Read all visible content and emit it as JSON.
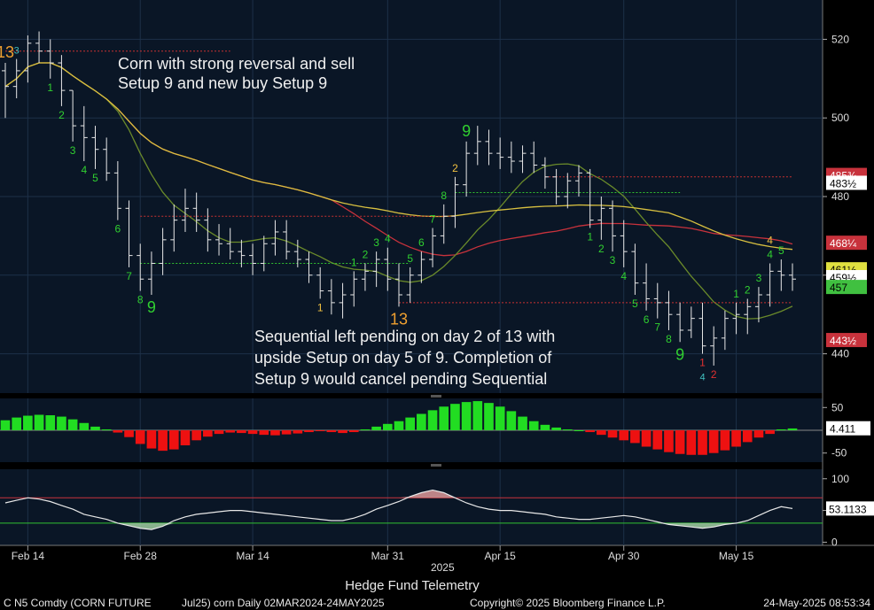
{
  "chart_data": {
    "type": "candlestick",
    "title": "",
    "instrument": "C N5 Comdty (CORN FUTURE    Jul25) corn  Daily 02MAR2024-24MAY2025",
    "footer_left": "C N5 Comdty (CORN FUTURE",
    "footer_mid": "Jul25) corn  Daily 02MAR2024-24MAY2025",
    "copyright": "Copyright© 2025 Bloomberg Finance L.P.",
    "timestamp": "24-May-2025 08:53:34",
    "watermark": "Hedge Fund Telemetry",
    "year_label": "2025",
    "date_ticks": [
      "Feb 14",
      "Feb 28",
      "Mar 14",
      "Mar 31",
      "Apr 15",
      "Apr 30",
      "May 15"
    ],
    "date_tick_index": [
      2,
      12,
      22,
      34,
      44,
      55,
      65
    ],
    "price_axis": {
      "ticks": [
        440,
        460,
        480,
        500,
        520
      ],
      "ylim": [
        430,
        530
      ]
    },
    "price_labels": {
      "last_left": "483½",
      "ma_red": "468¼",
      "last": "459½",
      "target": "443½",
      "hidden_a": "485¾",
      "hidden_b": "461½",
      "hidden_c": "457"
    },
    "ohlc": [
      [
        512,
        514,
        500,
        508
      ],
      [
        508,
        515,
        505,
        512
      ],
      [
        512,
        521,
        509,
        519
      ],
      [
        519,
        522,
        514,
        517
      ],
      [
        517,
        520,
        510,
        514
      ],
      [
        514,
        516,
        503,
        507
      ],
      [
        507,
        507,
        494,
        498
      ],
      [
        498,
        503,
        489,
        495
      ],
      [
        495,
        498,
        487,
        492
      ],
      [
        492,
        495,
        484,
        486
      ],
      [
        486,
        489,
        474,
        477
      ],
      [
        477,
        479,
        462,
        465
      ],
      [
        465,
        468,
        456,
        459
      ],
      [
        459,
        466,
        455,
        463
      ],
      [
        463,
        472,
        460,
        469
      ],
      [
        469,
        478,
        466,
        474
      ],
      [
        474,
        482,
        471,
        477
      ],
      [
        477,
        481,
        471,
        474
      ],
      [
        474,
        477,
        466,
        469
      ],
      [
        469,
        473,
        465,
        468
      ],
      [
        468,
        472,
        464,
        466
      ],
      [
        466,
        469,
        462,
        465
      ],
      [
        465,
        468,
        460,
        463
      ],
      [
        463,
        470,
        461,
        468
      ],
      [
        468,
        474,
        465,
        471
      ],
      [
        471,
        474,
        464,
        466
      ],
      [
        466,
        469,
        462,
        464
      ],
      [
        464,
        466,
        458,
        460
      ],
      [
        460,
        462,
        454,
        456
      ],
      [
        456,
        459,
        450,
        453
      ],
      [
        453,
        458,
        449,
        455
      ],
      [
        455,
        461,
        452,
        459
      ],
      [
        459,
        463,
        456,
        461
      ],
      [
        461,
        466,
        457,
        464
      ],
      [
        464,
        467,
        456,
        459
      ],
      [
        459,
        463,
        452,
        455
      ],
      [
        455,
        462,
        453,
        460
      ],
      [
        460,
        466,
        458,
        464
      ],
      [
        464,
        472,
        462,
        470
      ],
      [
        470,
        478,
        468,
        475
      ],
      [
        475,
        485,
        472,
        483
      ],
      [
        483,
        494,
        480,
        491
      ],
      [
        491,
        498,
        488,
        494
      ],
      [
        494,
        497,
        488,
        491
      ],
      [
        491,
        495,
        487,
        490
      ],
      [
        490,
        494,
        486,
        489
      ],
      [
        489,
        493,
        486,
        491
      ],
      [
        491,
        494,
        486,
        488
      ],
      [
        488,
        490,
        482,
        485
      ],
      [
        485,
        487,
        478,
        480
      ],
      [
        480,
        486,
        477,
        484
      ],
      [
        484,
        488,
        480,
        486
      ],
      [
        486,
        487,
        472,
        474
      ],
      [
        474,
        480,
        469,
        477
      ],
      [
        477,
        479,
        466,
        470
      ],
      [
        470,
        474,
        462,
        466
      ],
      [
        466,
        468,
        455,
        458
      ],
      [
        458,
        463,
        451,
        454
      ],
      [
        454,
        458,
        449,
        453
      ],
      [
        453,
        456,
        446,
        450
      ],
      [
        450,
        453,
        443,
        446
      ],
      [
        446,
        452,
        444,
        449
      ],
      [
        449,
        453,
        440,
        442
      ],
      [
        442,
        447,
        437,
        444
      ],
      [
        444,
        451,
        441,
        449
      ],
      [
        449,
        453,
        445,
        450
      ],
      [
        450,
        454,
        445,
        452
      ],
      [
        452,
        457,
        448,
        455
      ],
      [
        455,
        463,
        452,
        461
      ],
      [
        461,
        464,
        456,
        460
      ],
      [
        460,
        463,
        456,
        459
      ]
    ],
    "td_counts": [
      {
        "i": 0,
        "label": "13",
        "color": "#f0a030",
        "pos": "above",
        "size": 18
      },
      {
        "i": 1,
        "label": "3",
        "color": "#40c0c0",
        "pos": "above",
        "size": 11
      },
      {
        "i": 4,
        "label": "1",
        "color": "#30d030",
        "pos": "below",
        "size": 12
      },
      {
        "i": 5,
        "label": "2",
        "color": "#30d030",
        "pos": "below",
        "size": 12
      },
      {
        "i": 6,
        "label": "3",
        "color": "#30d030",
        "pos": "below",
        "size": 12
      },
      {
        "i": 7,
        "label": "4",
        "color": "#30d030",
        "pos": "below",
        "size": 12
      },
      {
        "i": 8,
        "label": "5",
        "color": "#30d030",
        "pos": "below",
        "size": 12
      },
      {
        "i": 10,
        "label": "6",
        "color": "#30d030",
        "pos": "below",
        "size": 12
      },
      {
        "i": 11,
        "label": "7",
        "color": "#30d030",
        "pos": "below",
        "size": 12
      },
      {
        "i": 12,
        "label": "8",
        "color": "#30d030",
        "pos": "below",
        "size": 12
      },
      {
        "i": 13,
        "label": "9",
        "color": "#30d030",
        "pos": "below",
        "size": 18
      },
      {
        "i": 28,
        "label": "1",
        "color": "#f0c040",
        "pos": "below",
        "size": 12
      },
      {
        "i": 31,
        "label": "1",
        "color": "#30d030",
        "pos": "above",
        "size": 12
      },
      {
        "i": 32,
        "label": "2",
        "color": "#30d030",
        "pos": "above",
        "size": 12
      },
      {
        "i": 33,
        "label": "3",
        "color": "#30d030",
        "pos": "above",
        "size": 12
      },
      {
        "i": 34,
        "label": "4",
        "color": "#30d030",
        "pos": "above",
        "size": 12
      },
      {
        "i": 35,
        "label": "13",
        "color": "#f0a030",
        "pos": "below",
        "size": 18
      },
      {
        "i": 36,
        "label": "5",
        "color": "#30d030",
        "pos": "above",
        "size": 12
      },
      {
        "i": 37,
        "label": "6",
        "color": "#30d030",
        "pos": "above",
        "size": 12
      },
      {
        "i": 38,
        "label": "7",
        "color": "#30d030",
        "pos": "above",
        "size": 12
      },
      {
        "i": 39,
        "label": "8",
        "color": "#30d030",
        "pos": "above",
        "size": 12
      },
      {
        "i": 40,
        "label": "2",
        "color": "#f0c040",
        "pos": "above",
        "size": 12
      },
      {
        "i": 41,
        "label": "9",
        "color": "#30d030",
        "pos": "above",
        "size": 18
      },
      {
        "i": 52,
        "label": "1",
        "color": "#30d030",
        "pos": "below",
        "size": 12
      },
      {
        "i": 53,
        "label": "2",
        "color": "#30d030",
        "pos": "below",
        "size": 12
      },
      {
        "i": 54,
        "label": "3",
        "color": "#30d030",
        "pos": "below",
        "size": 12
      },
      {
        "i": 55,
        "label": "4",
        "color": "#30d030",
        "pos": "below",
        "size": 12
      },
      {
        "i": 56,
        "label": "5",
        "color": "#30d030",
        "pos": "below",
        "size": 12
      },
      {
        "i": 57,
        "label": "6",
        "color": "#30d030",
        "pos": "below",
        "size": 12
      },
      {
        "i": 58,
        "label": "7",
        "color": "#30d030",
        "pos": "below",
        "size": 12
      },
      {
        "i": 59,
        "label": "8",
        "color": "#30d030",
        "pos": "below",
        "size": 12
      },
      {
        "i": 60,
        "label": "9",
        "color": "#30d030",
        "pos": "below",
        "size": 18
      },
      {
        "i": 62,
        "label": "1",
        "color": "#e03030",
        "pos": "below",
        "size": 12
      },
      {
        "i": 63,
        "label": "2",
        "color": "#e03030",
        "pos": "below",
        "size": 12
      },
      {
        "i": 62,
        "label": "4",
        "color": "#40c0c0",
        "pos": "below2",
        "size": 11
      },
      {
        "i": 65,
        "label": "1",
        "color": "#30d030",
        "pos": "above",
        "size": 12
      },
      {
        "i": 66,
        "label": "2",
        "color": "#30d030",
        "pos": "above",
        "size": 12
      },
      {
        "i": 67,
        "label": "3",
        "color": "#30d030",
        "pos": "above",
        "size": 12
      },
      {
        "i": 68,
        "label": "4",
        "color": "#30d030",
        "pos": "above",
        "size": 12
      },
      {
        "i": 69,
        "label": "5",
        "color": "#30d030",
        "pos": "above",
        "size": 12
      },
      {
        "i": 68,
        "label": "4",
        "color": "#f0c040",
        "pos": "above2",
        "size": 12
      }
    ],
    "annotations": [
      {
        "text": "Corn with strong reversal and sell",
        "text2": "Setup 9 and new buy Setup 9"
      },
      {
        "text": "Sequential left pending on day 2 of 13 with",
        "text2": "upside Setup on day 5 of 9. Completion of",
        "text3": "Setup 9 would cancel pending Sequential"
      }
    ],
    "momentum": {
      "axis_ticks": [
        50,
        -50
      ],
      "ylim": [
        -70,
        70
      ],
      "last_label": "4.411",
      "values": [
        22,
        28,
        32,
        34,
        33,
        30,
        24,
        16,
        8,
        2,
        -5,
        -15,
        -30,
        -40,
        -45,
        -42,
        -33,
        -22,
        -14,
        -8,
        -5,
        -6,
        -8,
        -10,
        -11,
        -9,
        -7,
        -4,
        -2,
        -4,
        -6,
        -4,
        2,
        8,
        14,
        20,
        28,
        36,
        44,
        52,
        58,
        62,
        64,
        60,
        52,
        42,
        30,
        20,
        12,
        6,
        2,
        0,
        -4,
        -10,
        -16,
        -22,
        -28,
        -36,
        -42,
        -48,
        -52,
        -54,
        -54,
        -50,
        -44,
        -36,
        -26,
        -16,
        -8,
        2,
        4
      ]
    },
    "oscillator": {
      "axis_ticks": [
        100,
        50,
        0
      ],
      "ylim": [
        -5,
        115
      ],
      "upper": 70,
      "lower": 30,
      "last_label": "53.1133",
      "values": [
        62,
        66,
        70,
        68,
        64,
        58,
        52,
        44,
        40,
        36,
        30,
        26,
        22,
        20,
        25,
        34,
        40,
        44,
        46,
        48,
        50,
        50,
        48,
        46,
        44,
        42,
        40,
        38,
        36,
        34,
        34,
        38,
        44,
        52,
        58,
        64,
        72,
        78,
        82,
        78,
        70,
        62,
        56,
        52,
        50,
        50,
        48,
        46,
        44,
        40,
        38,
        36,
        36,
        38,
        40,
        42,
        40,
        36,
        32,
        28,
        26,
        24,
        22,
        24,
        28,
        30,
        34,
        42,
        50,
        56,
        53
      ]
    }
  }
}
